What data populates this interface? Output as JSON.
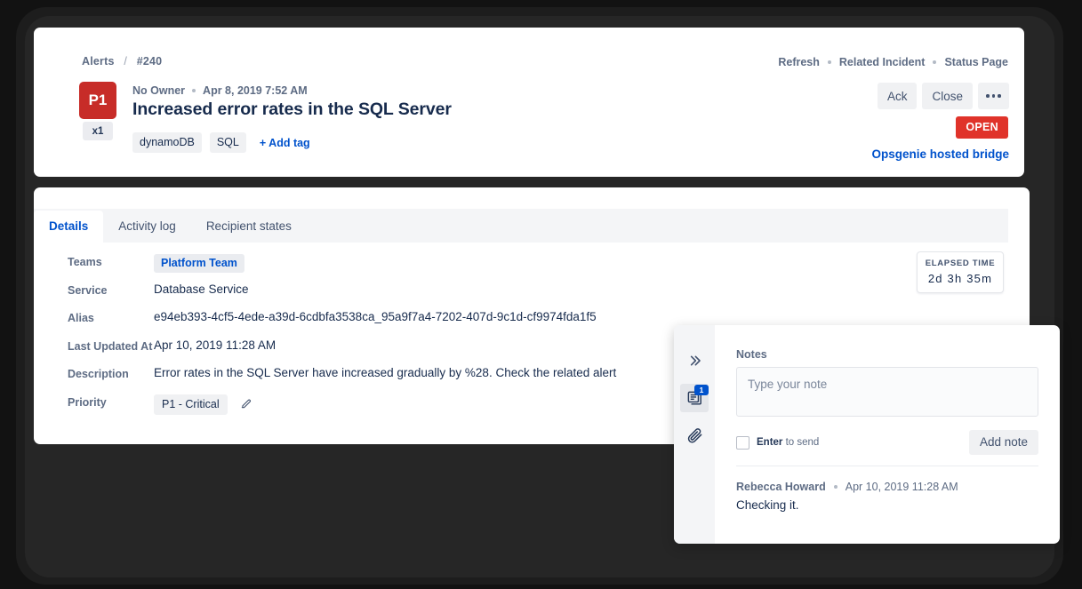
{
  "breadcrumb": {
    "root": "Alerts",
    "separator": "/",
    "current": "#240"
  },
  "header": {
    "priority_badge": "P1",
    "count_badge": "x1",
    "owner": "No Owner",
    "created_at": "Apr 8, 2019 7:52 AM",
    "title": "Increased error rates in the SQL Server",
    "tags": [
      "dynamoDB",
      "SQL"
    ],
    "add_tag_label": "+ Add tag",
    "links": [
      "Refresh",
      "Related Incident",
      "Status Page"
    ],
    "buttons": [
      "Ack",
      "Close"
    ],
    "more_icon": "ellipsis-icon",
    "status": "OPEN",
    "bridge_link": "Opsgenie hosted bridge",
    "colors": {
      "priority_red": "#c72c28",
      "status_red": "#e0332a",
      "link_blue": "#0052cc"
    }
  },
  "tabs": [
    {
      "label": "Details",
      "active": true
    },
    {
      "label": "Activity log",
      "active": false
    },
    {
      "label": "Recipient states",
      "active": false
    }
  ],
  "details": [
    {
      "label": "Teams",
      "value": "Platform Team",
      "type": "chip"
    },
    {
      "label": "Service",
      "value": "Database Service",
      "type": "text"
    },
    {
      "label": "Alias",
      "value": "e94eb393-4cf5-4ede-a39d-6cdbfa3538ca_95a9f7a4-7202-407d-9c1d-cf9974fda1f5",
      "type": "text"
    },
    {
      "label": "Last Updated At",
      "value": "Apr 10, 2019 11:28 AM",
      "type": "text"
    },
    {
      "label": "Description",
      "value": "Error rates in the SQL Server have increased gradually by %28. Check the related alert",
      "type": "text"
    },
    {
      "label": "Priority",
      "value": "P1 - Critical",
      "type": "chip-edit"
    }
  ],
  "elapsed": {
    "label": "ELAPSED TIME",
    "value": "2d  3h  35m"
  },
  "notes_panel": {
    "rail": [
      {
        "name": "collapse-icon",
        "badge": null
      },
      {
        "name": "notes-icon",
        "badge": "1"
      },
      {
        "name": "attachment-icon",
        "badge": null
      }
    ],
    "title": "Notes",
    "input_placeholder": "Type your note",
    "input_value": "",
    "enter_to_send_strong": "Enter",
    "enter_to_send_rest": "to send",
    "add_note_label": "Add note",
    "entries": [
      {
        "author": "Rebecca Howard",
        "timestamp": "Apr 10, 2019 11:28 AM",
        "text": "Checking it."
      }
    ]
  }
}
